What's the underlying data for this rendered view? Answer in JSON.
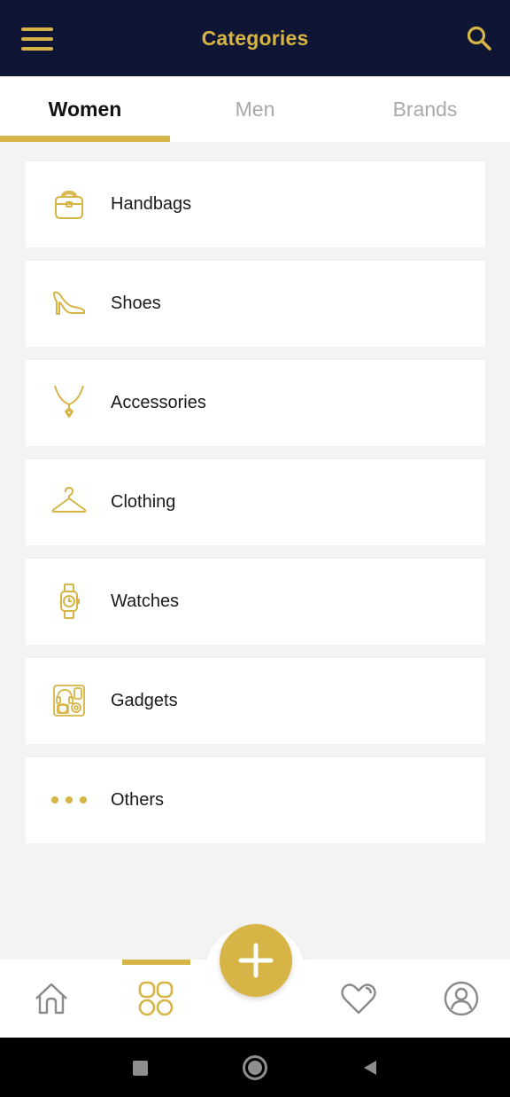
{
  "header": {
    "title": "Categories",
    "menu_icon": "hamburger-menu-icon",
    "search_icon": "search-icon"
  },
  "tabs": [
    {
      "label": "Women",
      "active": true
    },
    {
      "label": "Men",
      "active": false
    },
    {
      "label": "Brands",
      "active": false
    }
  ],
  "categories": [
    {
      "label": "Handbags",
      "icon": "handbag-icon"
    },
    {
      "label": "Shoes",
      "icon": "high-heel-icon"
    },
    {
      "label": "Accessories",
      "icon": "necklace-icon"
    },
    {
      "label": "Clothing",
      "icon": "hanger-icon"
    },
    {
      "label": "Watches",
      "icon": "watch-icon"
    },
    {
      "label": "Gadgets",
      "icon": "gadgets-icon"
    },
    {
      "label": "Others",
      "icon": "more-dots-icon"
    }
  ],
  "bottom_nav": {
    "items": [
      {
        "icon": "home-icon",
        "active": false
      },
      {
        "icon": "categories-grid-icon",
        "active": true
      },
      {
        "icon": "add-icon",
        "active": false
      },
      {
        "icon": "heart-icon",
        "active": false
      },
      {
        "icon": "profile-icon",
        "active": false
      }
    ]
  },
  "system_nav": {
    "items": [
      "recent-apps-icon",
      "home-circle-icon",
      "back-icon"
    ]
  },
  "colors": {
    "accent": "#d6b445",
    "header_bg": "#0f1534",
    "page_bg": "#f3f3f3",
    "card_bg": "#ffffff",
    "inactive_tab": "#a9a9a9",
    "nav_icon": "#8a8a8a"
  }
}
